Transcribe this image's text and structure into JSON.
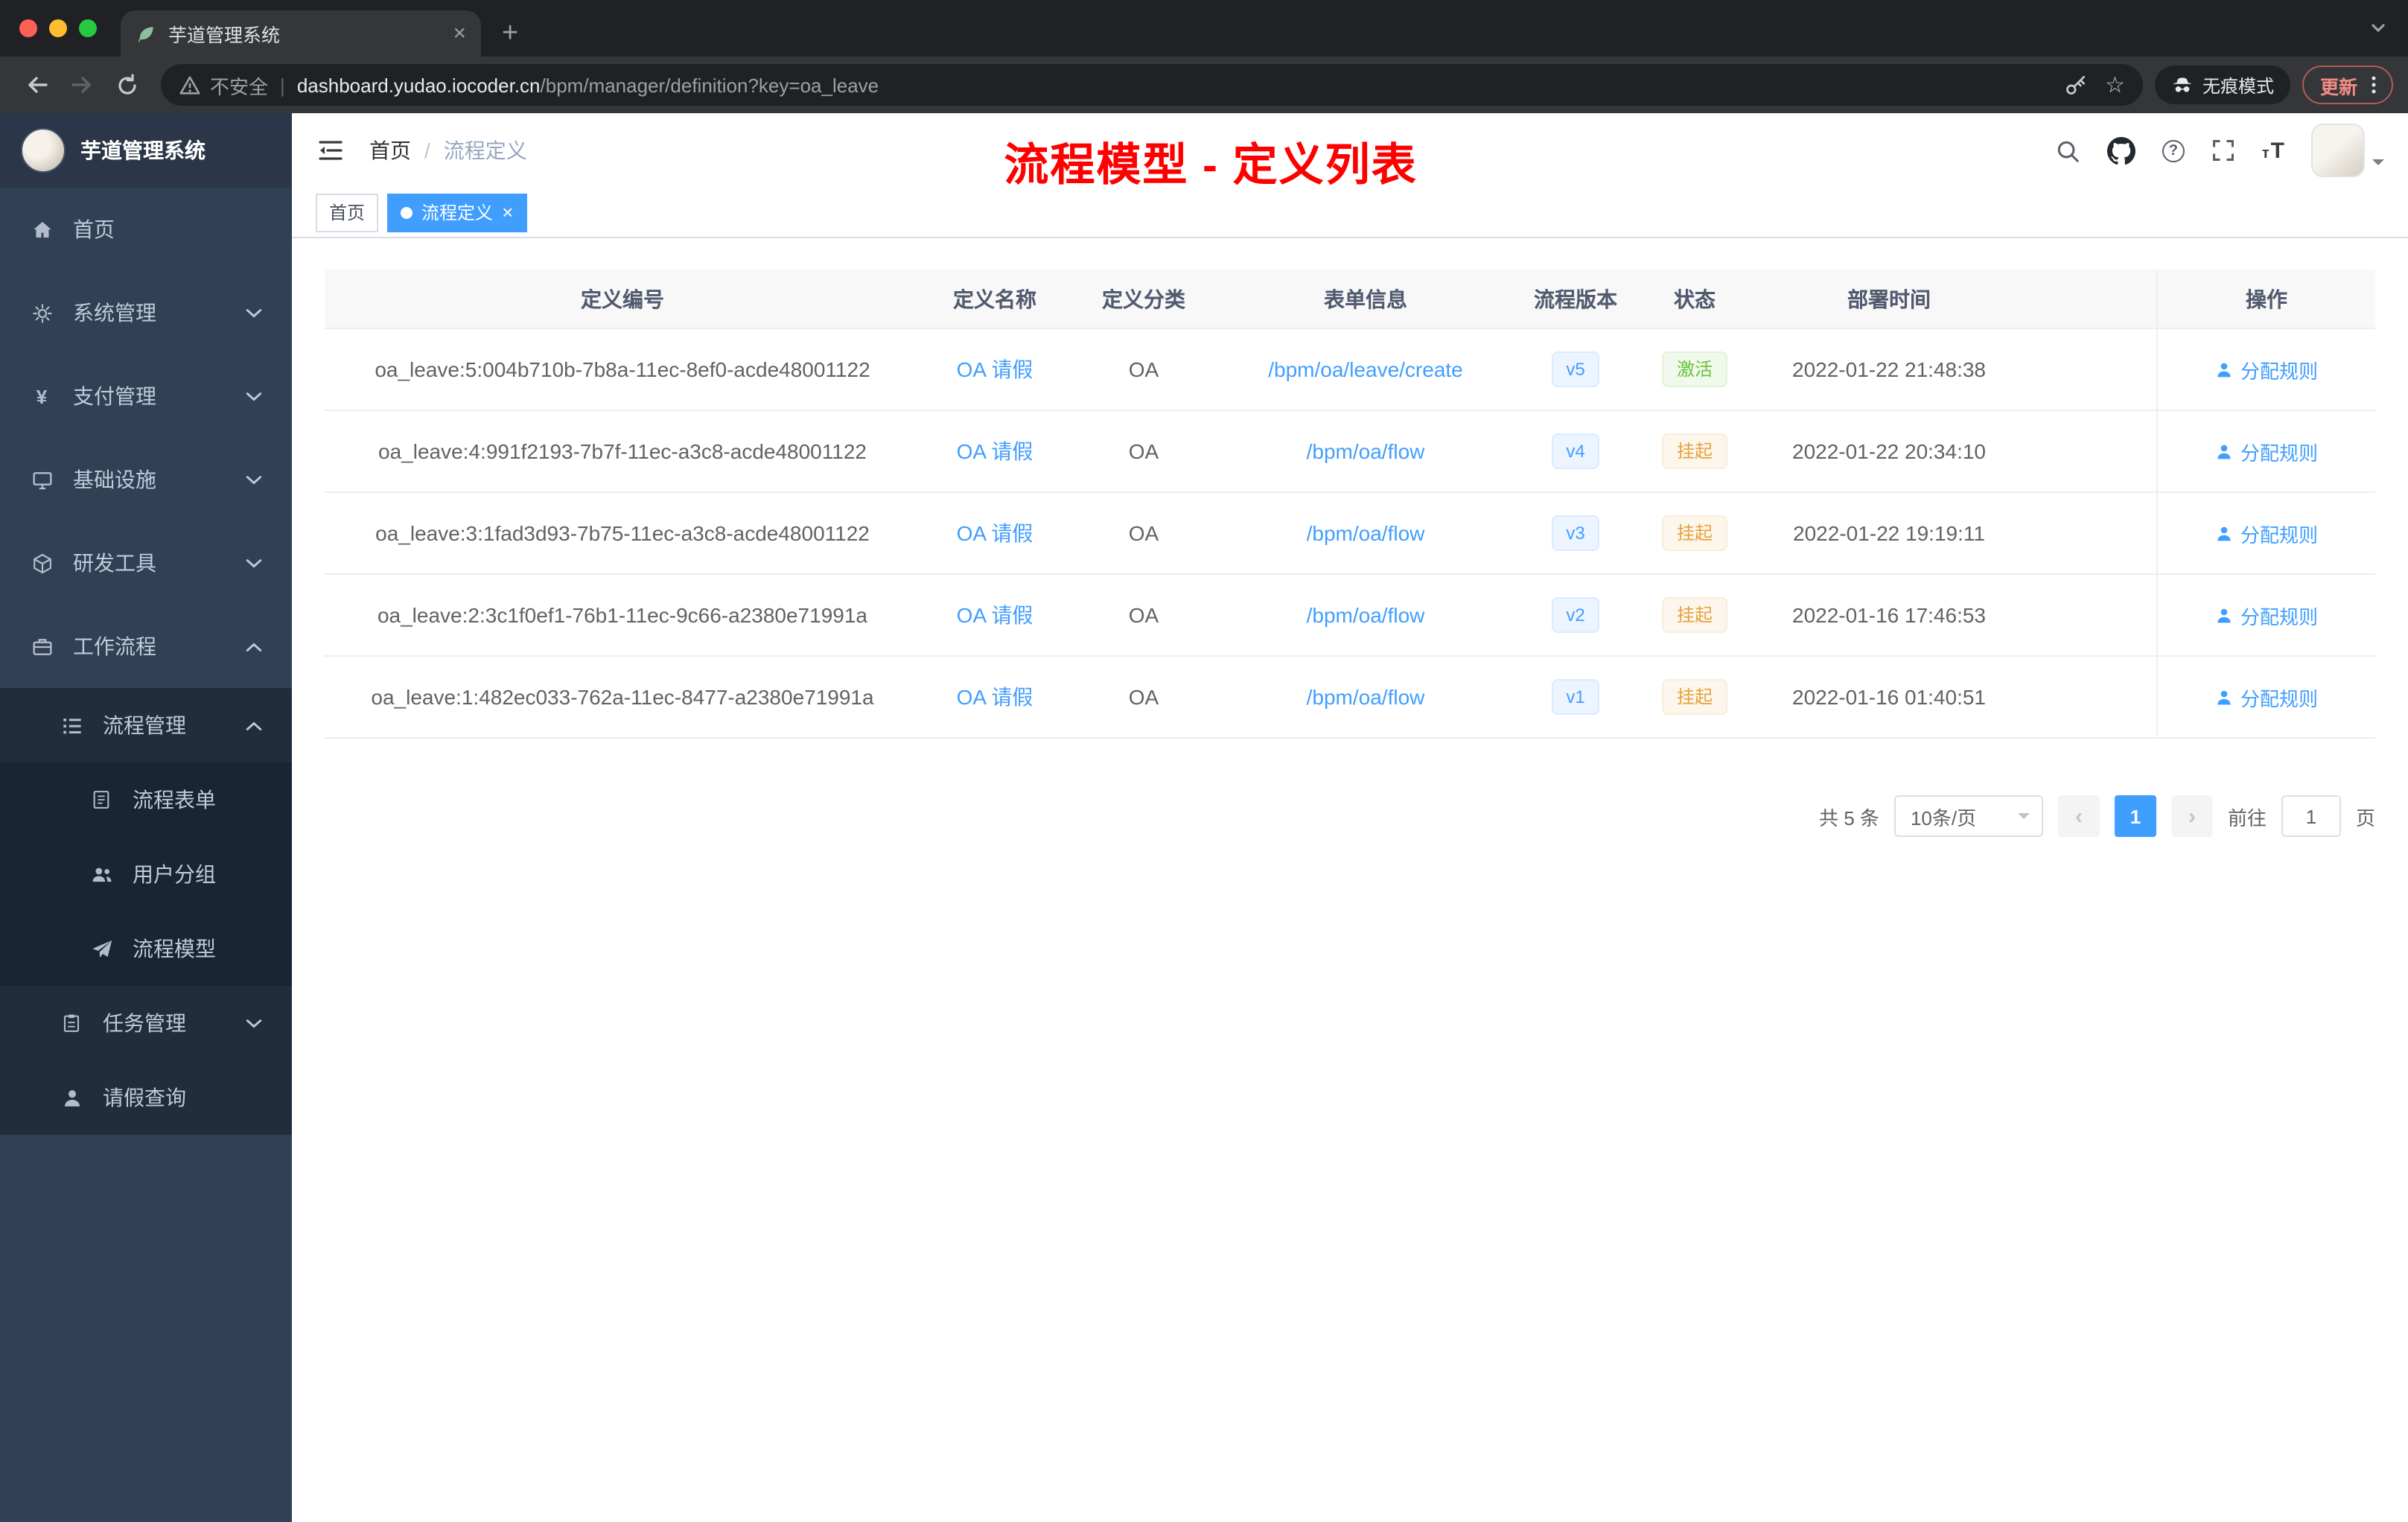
{
  "browser": {
    "tab_title": "芋道管理系统",
    "security_label": "不安全",
    "url_host": "dashboard.yudao.iocoder.cn",
    "url_path": "/bpm/manager/definition?key=oa_leave",
    "incognito_label": "无痕模式",
    "update_label": "更新"
  },
  "icons": {
    "close": "×",
    "new_tab": "+",
    "question": "?",
    "yen": "¥",
    "star": "☆",
    "prev_arrow": "‹",
    "next_arrow": "›",
    "size_small": "т",
    "size_big": "T"
  },
  "sidebar": {
    "logo_title": "芋道管理系统",
    "home": "首页",
    "system": "系统管理",
    "pay": "支付管理",
    "infra": "基础设施",
    "dev": "研发工具",
    "workflow": "工作流程",
    "process_mgmt": "流程管理",
    "process_form": "流程表单",
    "user_group": "用户分组",
    "process_model": "流程模型",
    "task_mgmt": "任务管理",
    "leave_query": "请假查询"
  },
  "header": {
    "breadcrumb_home": "首页",
    "breadcrumb_sep": "/",
    "breadcrumb_current": "流程定义",
    "annotation": "流程模型 - 定义列表"
  },
  "tags": {
    "home": "首页",
    "active": "流程定义"
  },
  "table": {
    "columns": [
      "定义编号",
      "定义名称",
      "定义分类",
      "表单信息",
      "流程版本",
      "状态",
      "部署时间",
      "操作"
    ],
    "rows": [
      {
        "id": "oa_leave:5:004b710b-7b8a-11ec-8ef0-acde48001122",
        "name": "OA 请假",
        "category": "OA",
        "form": "/bpm/oa/leave/create",
        "version": "v5",
        "status": "激活",
        "status_class": "success",
        "time": "2022-01-22 21:48:38",
        "action": "分配规则"
      },
      {
        "id": "oa_leave:4:991f2193-7b7f-11ec-a3c8-acde48001122",
        "name": "OA 请假",
        "category": "OA",
        "form": "/bpm/oa/flow",
        "version": "v4",
        "status": "挂起",
        "status_class": "warning",
        "time": "2022-01-22 20:34:10",
        "action": "分配规则"
      },
      {
        "id": "oa_leave:3:1fad3d93-7b75-11ec-a3c8-acde48001122",
        "name": "OA 请假",
        "category": "OA",
        "form": "/bpm/oa/flow",
        "version": "v3",
        "status": "挂起",
        "status_class": "warning",
        "time": "2022-01-22 19:19:11",
        "action": "分配规则"
      },
      {
        "id": "oa_leave:2:3c1f0ef1-76b1-11ec-9c66-a2380e71991a",
        "name": "OA 请假",
        "category": "OA",
        "form": "/bpm/oa/flow",
        "version": "v2",
        "status": "挂起",
        "status_class": "warning",
        "time": "2022-01-16 17:46:53",
        "action": "分配规则"
      },
      {
        "id": "oa_leave:1:482ec033-762a-11ec-8477-a2380e71991a",
        "name": "OA 请假",
        "category": "OA",
        "form": "/bpm/oa/flow",
        "version": "v1",
        "status": "挂起",
        "status_class": "warning",
        "time": "2022-01-16 01:40:51",
        "action": "分配规则"
      }
    ]
  },
  "pagination": {
    "total": "共 5 条",
    "page_size": "10条/页",
    "page": "1",
    "goto": "前往",
    "goto_value": "1",
    "unit": "页"
  },
  "colors": {
    "accent": "#409eff",
    "sidebar_bg": "#304156",
    "submenu_bg": "#1f2d3d",
    "status_active": "#67c23a",
    "status_suspended": "#e6a23c",
    "annotation_red": "#ff0000",
    "tab_active": "#35363a",
    "tabstrip_bg": "#202124"
  }
}
